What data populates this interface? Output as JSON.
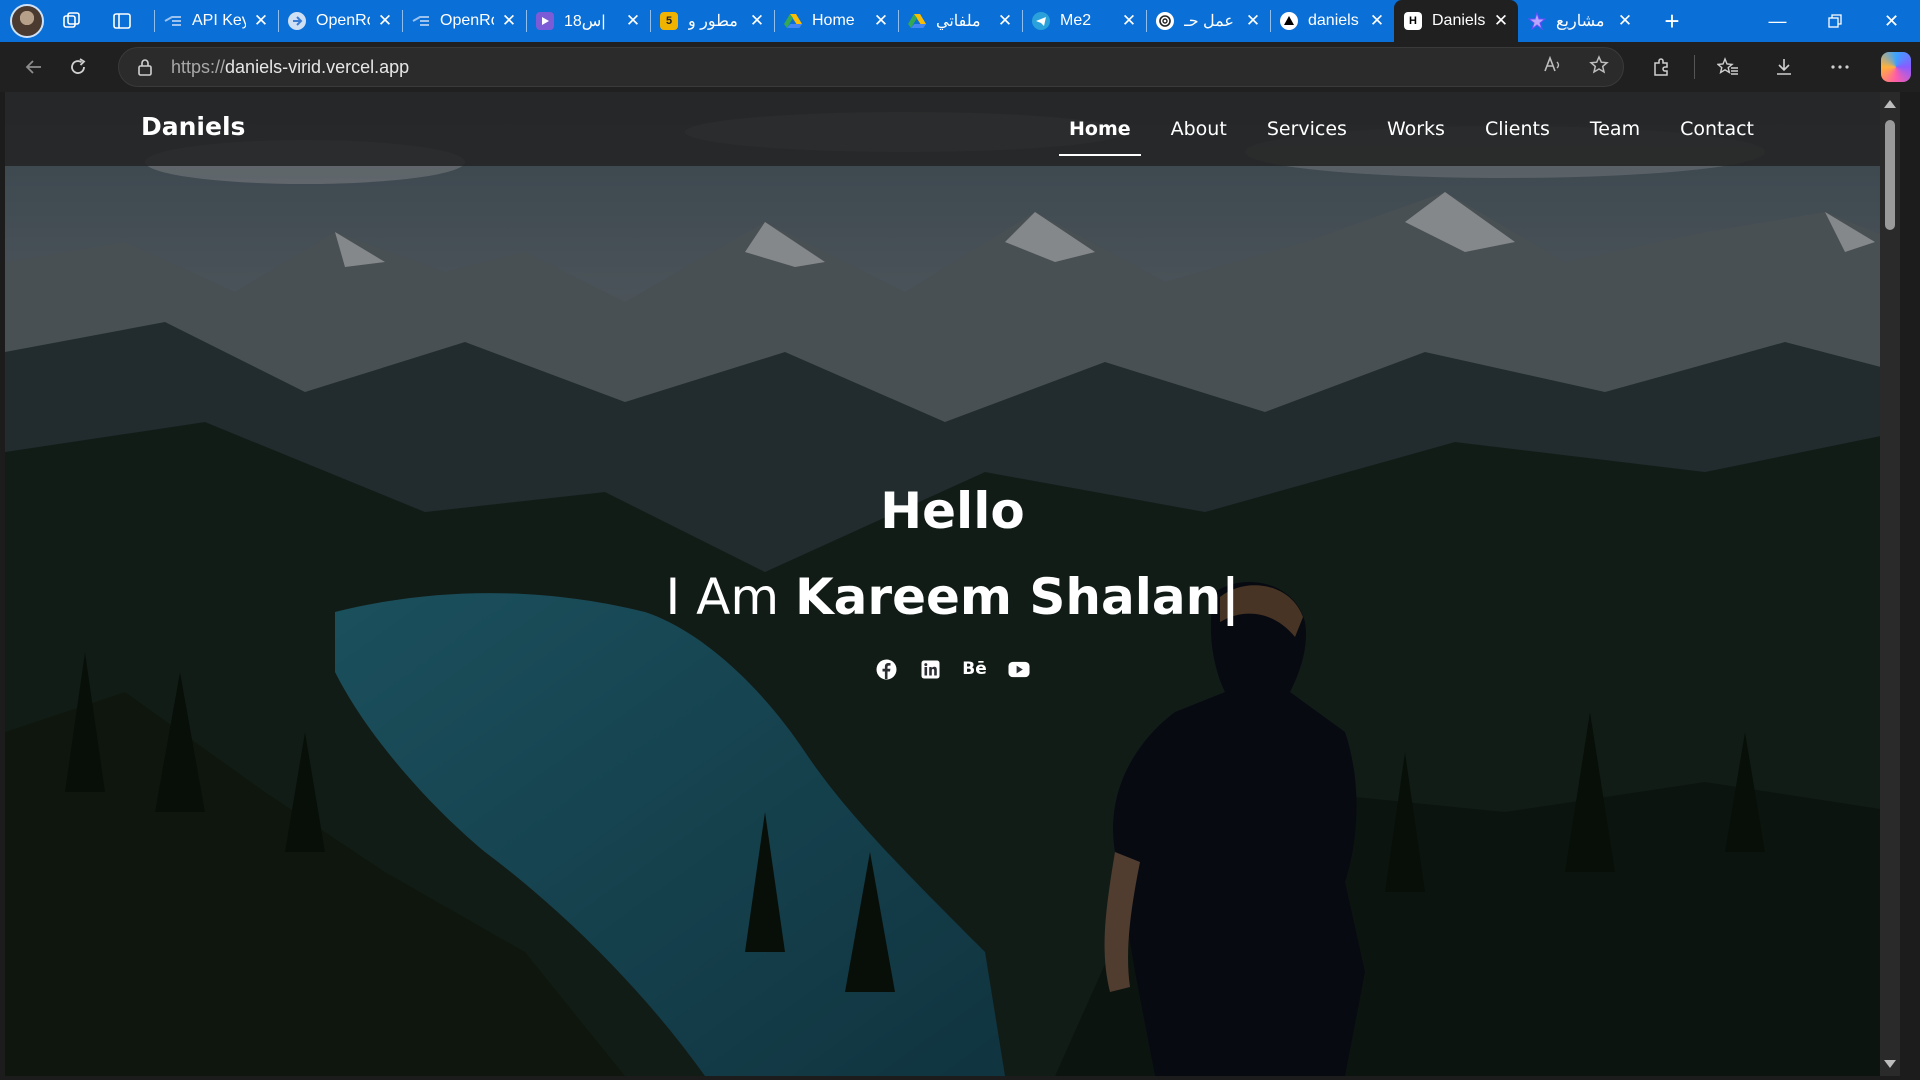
{
  "browser": {
    "tabs": [
      {
        "title": "API Key",
        "favicon": "openrouter-icon",
        "color": "#3a7bd5"
      },
      {
        "title": "OpenRo",
        "favicon": "openrouter-icon",
        "color": "#7aa6e0"
      },
      {
        "title": "OpenRo",
        "favicon": "openrouter-icon",
        "color": "#3a7bd5"
      },
      {
        "title": "س18|",
        "favicon": "video-icon",
        "color": "#7b5cd6"
      },
      {
        "title": "مطور و",
        "favicon": "badge-5-icon",
        "color": "#f0b400",
        "badge": "5"
      },
      {
        "title": "Home",
        "favicon": "drive-icon",
        "color": "#34a853"
      },
      {
        "title": "ملفاتي",
        "favicon": "drive-icon",
        "color": "#34a853"
      },
      {
        "title": "Me2",
        "favicon": "telegram-icon",
        "color": "#2aa1da"
      },
      {
        "title": "عمل حـ",
        "favicon": "chatgpt-icon",
        "color": "#ffffff"
      },
      {
        "title": "daniels",
        "favicon": "vercel-icon",
        "color": "#000000"
      },
      {
        "title": "Daniels",
        "favicon": "h-logo-icon",
        "color": "#000000",
        "badge": "H",
        "active": true
      },
      {
        "title": "مشاريع",
        "favicon": "star-logo-icon",
        "color": "#7a5cff"
      }
    ],
    "url_scheme": "https://",
    "url_host": "daniels-virid.vercel.app"
  },
  "site": {
    "brand": "Daniels",
    "nav": [
      "Home",
      "About",
      "Services",
      "Works",
      "Clients",
      "Team",
      "Contact"
    ],
    "active_nav": "Home",
    "hero": {
      "greeting": "Hello",
      "prefix": "I Am ",
      "name": "Kareem Shalan",
      "cursor": "|"
    },
    "socials": [
      "facebook-icon",
      "linkedin-icon",
      "behance-icon",
      "youtube-icon"
    ],
    "behance_text": "Bē"
  }
}
